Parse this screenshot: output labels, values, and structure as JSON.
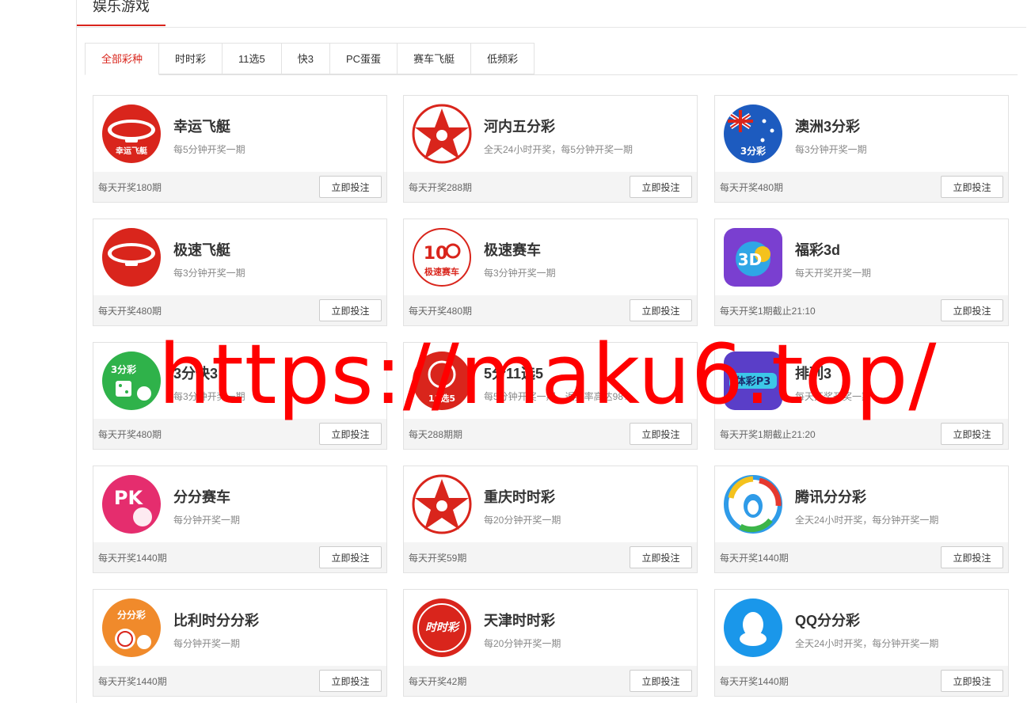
{
  "section": {
    "title": "娱乐游戏"
  },
  "tabs": [
    "全部彩种",
    "时时彩",
    "11选5",
    "快3",
    "PC蛋蛋",
    "赛车飞艇",
    "低频彩"
  ],
  "bet_label": "立即投注",
  "games": [
    {
      "name": "幸运飞艇",
      "desc": "每5分钟开奖一期",
      "count": "每天开奖180期",
      "icon": "airship-icon",
      "logo_text": "幸运飞艇"
    },
    {
      "name": "河内五分彩",
      "desc": "全天24小时开奖，每5分钟开奖一期",
      "count": "每天开奖288期",
      "icon": "star-logo-icon"
    },
    {
      "name": "澳洲3分彩",
      "desc": "每3分钟开奖一期",
      "count": "每天开奖480期",
      "icon": "australia-flag-icon",
      "logo_text": "3分彩"
    },
    {
      "name": "极速飞艇",
      "desc": "每3分钟开奖一期",
      "count": "每天开奖480期",
      "icon": "airship-icon"
    },
    {
      "name": "极速赛车",
      "desc": "每3分钟开奖一期",
      "count": "每天开奖480期",
      "icon": "racing-10-icon",
      "logo_text": "极速赛车"
    },
    {
      "name": "福彩3d",
      "desc": "每天开奖开奖一期",
      "count": "每天开奖1期截止21:10",
      "icon": "fucai-3d-icon",
      "logo_text": "3D"
    },
    {
      "name": "3分快3",
      "desc": "每3分钟开奖一期",
      "count": "每天开奖480期",
      "icon": "dice-icon",
      "logo_text": "3分彩"
    },
    {
      "name": "5分11选5",
      "desc": "每5分钟开奖一期，返奖率高达98%",
      "count": "每天288期期",
      "icon": "11x5-icon",
      "logo_text": "11选5"
    },
    {
      "name": "排列3",
      "desc": "每天开奖开奖一期",
      "count": "每天开奖1期截止21:20",
      "icon": "tiyu-p3-icon",
      "logo_text": "体彩P3"
    },
    {
      "name": "分分赛车",
      "desc": "每分钟开奖一期",
      "count": "每天开奖1440期",
      "icon": "pk10-icon",
      "logo_text": "PK"
    },
    {
      "name": "重庆时时彩",
      "desc": "每20分钟开奖一期",
      "count": "每天开奖59期",
      "icon": "star-logo-icon"
    },
    {
      "name": "腾讯分分彩",
      "desc": "全天24小时开奖，每分钟开奖一期",
      "count": "每天开奖1440期",
      "icon": "tencent-icon"
    },
    {
      "name": "比利时分分彩",
      "desc": "每分钟开奖一期",
      "count": "每天开奖1440期",
      "icon": "stopwatch-icon",
      "logo_text": "分分彩"
    },
    {
      "name": "天津时时彩",
      "desc": "每20分钟开奖一期",
      "count": "每天开奖42期",
      "icon": "shishicai-icon",
      "logo_text": "时时彩"
    },
    {
      "name": "QQ分分彩",
      "desc": "全天24小时开奖，每分钟开奖一期",
      "count": "每天开奖1440期",
      "icon": "qq-penguin-icon"
    }
  ],
  "watermark": "https://maku6.top/",
  "colors": {
    "accent": "#d9251c",
    "footer_bg": "#f4f4f4",
    "watermark": "#ff0000"
  }
}
